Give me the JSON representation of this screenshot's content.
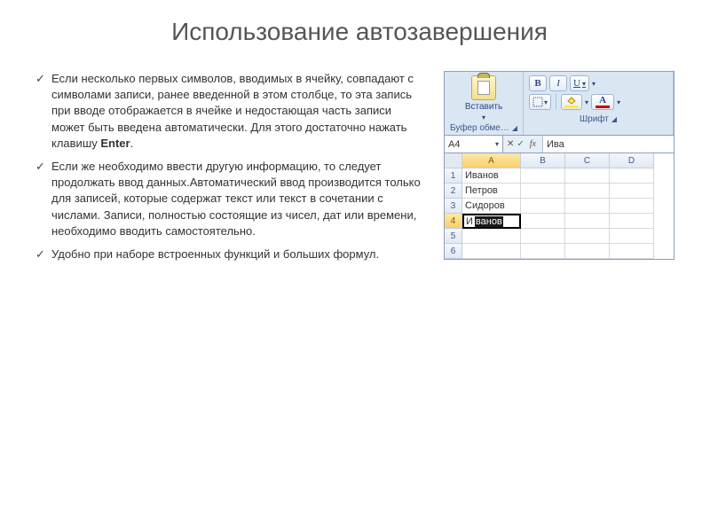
{
  "title": "Использование автозавершения",
  "bullets": [
    {
      "pre": "Если несколько первых символов, вводимых в ячейку, совпадают с символами записи, ранее введенной в этом столбце, то эта запись при вводе отображается в ячейке и недостающая часть записи может быть введена автоматически. Для этого достаточно нажать клавишу ",
      "key": "Enter",
      "post": "."
    },
    {
      "pre": "Если же необходимо ввести другую информацию, то следует продолжать ввод данных.Автоматический ввод производится только для записей, которые содержат текст или текст в сочетании с числами. Записи, полностью состоящие из чисел, дат или времени, необходимо вводить самостоятельно.",
      "key": "",
      "post": ""
    },
    {
      "pre": "Удобно при наборе встроенных функций и больших формул.",
      "key": "",
      "post": ""
    }
  ],
  "excel": {
    "paste_label": "Вставить",
    "clipboard_group": "Буфер обме…",
    "font_group": "Шрифт",
    "bold": "B",
    "italic": "I",
    "underline": "U",
    "fontcolor_A": "A",
    "fillcolor_A": "A",
    "namebox": "A4",
    "fx": "fx",
    "fbar_value": "Ива",
    "cols": [
      "A",
      "B",
      "C",
      "D"
    ],
    "rows": [
      "1",
      "2",
      "3",
      "4",
      "5",
      "6"
    ],
    "data": {
      "A1": "Иванов",
      "A2": "Петров",
      "A3": "Сидоров"
    },
    "editing": {
      "typed": "И",
      "autocomplete": "ванов"
    }
  }
}
